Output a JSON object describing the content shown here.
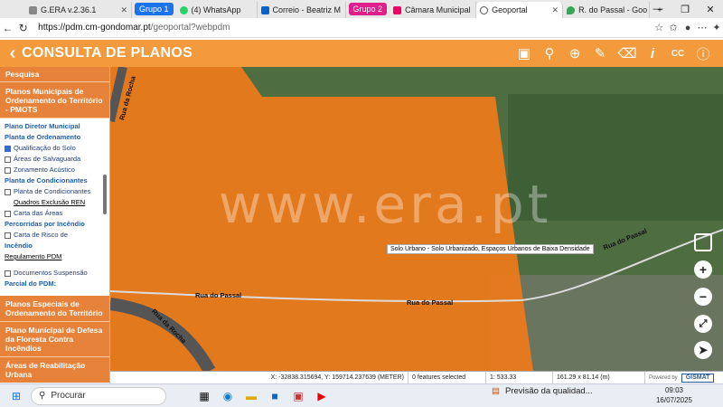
{
  "browser": {
    "tabs": [
      {
        "label": "G.ERA v.2.36.1",
        "fav": "#888"
      },
      {
        "label": "(4) WhatsApp",
        "fav": "#25d366"
      },
      {
        "label": "Correio - Beatriz M",
        "fav": "#0a64c8"
      },
      {
        "label": "Câmara Municipal",
        "fav": "#e06"
      },
      {
        "label": "Geoportal",
        "fav": "#555"
      },
      {
        "label": "R. do Passal - Goo",
        "fav": "#34a853"
      }
    ],
    "groups": [
      "Grupo 1",
      "Grupo 2"
    ],
    "group_colors": [
      "#1a73e8",
      "#e0208a"
    ],
    "url_host": "https://pdm.cm-gondomar.pt",
    "url_path": "/geoportal?webpdm"
  },
  "app": {
    "title": "CONSULTA DE PLANOS",
    "back_icon": "chevron-left-icon",
    "header_icons": [
      "layers-icon",
      "search-icon",
      "crosshair-icon",
      "pencil-icon",
      "eraser-icon",
      "info-i-icon",
      "cc-icon",
      "info-circle-icon"
    ]
  },
  "sidebar": {
    "search": "Pesquisa",
    "pmot": "Planos Municipais de Ordenamento do Território - PMOTS",
    "pdm_head": "Plano Diretor Municipal",
    "ordenamento_head": "Planta de Ordenamento",
    "items": [
      {
        "label": "Qualificação do Solo",
        "checked": true
      },
      {
        "label": "Áreas de Salvaguarda",
        "checked": false
      },
      {
        "label": "Zonamento Acústico",
        "checked": false
      }
    ],
    "condicionantes_head": "Planta de Condicionantes",
    "condicionantes_item": "Planta de Condicionantes",
    "quadros": "Quadros Exclusão REN",
    "carta_areas": "Carta das Áreas",
    "percorridas": "Percorridas por Incêndio",
    "carta_risco": "Carta de Risco de",
    "incendio": "Incêndio",
    "regulamento": "Regulamento PDM",
    "documentos": "Documentos Suspensão",
    "parcial": "Parcial do PDM:",
    "especiais": "Planos Especiais de Ordenamento do Território",
    "defesa": "Plano Municipal de Defesa da Floresta Contra Incêndios",
    "reabilitacao": "Áreas de Reabilitação Urbana"
  },
  "map": {
    "watermark": "www.era.pt",
    "tooltip": "Solo Urbano - Solo Urbanizado, Espaços Urbanos de Baixa Densidade",
    "roads": [
      "Rua do Passal",
      "Rua do Passal",
      "Rua do Passal",
      "Rua da Rocha",
      "Rua da Rocha"
    ],
    "controls": [
      "+",
      "−"
    ],
    "fill_color": "#f07a1a"
  },
  "status": {
    "coords": "X: -32838.315694, Y: 159714.237639 (METER)",
    "features": "0 features selected",
    "scale": "1: 533.33",
    "extent": "161.29 x 81.14 (m)",
    "powered": "Powered by",
    "brand": "GISMAT"
  },
  "taskbar": {
    "search": "Procurar",
    "news": "Previsão da qualidad...",
    "time": "09:03",
    "date": "16/07/2025"
  }
}
